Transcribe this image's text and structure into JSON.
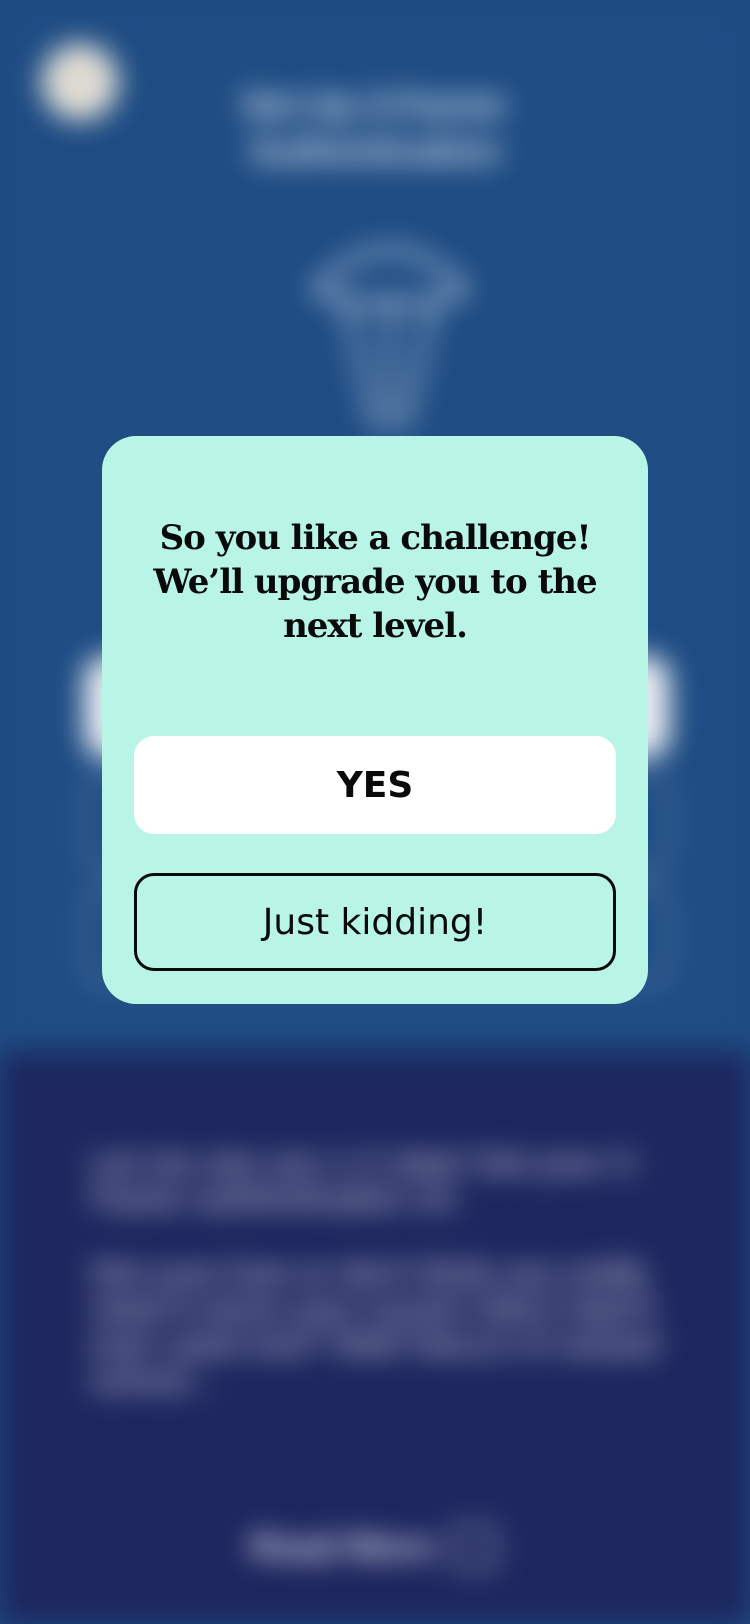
{
  "background": {
    "close_icon": "close-icon",
    "title": "Set Up 2-Factor Authentication",
    "illustration_icon": "parachute-icon",
    "paragraph_1": "Let me see you 1-2 step! Get your 2-Factor authentication on.",
    "paragraph_2": "Not sure how or don't think you really need it since your cousin Harry hasn't ever used one? Well Harry's in wizard school...",
    "read_more_label": "Read More",
    "read_more_icon": "external-link-icon"
  },
  "modal": {
    "message": "So you like a challenge! We’ll upgrade you to the next level.",
    "yes_label": "YES",
    "no_label": "Just kidding!"
  },
  "colors": {
    "background_top": "#1e4c83",
    "background_bottom": "#1d265e",
    "modal_bg": "#b8f5e6",
    "primary_button_bg": "#ffffff",
    "text_dark": "#0a0a0a"
  }
}
